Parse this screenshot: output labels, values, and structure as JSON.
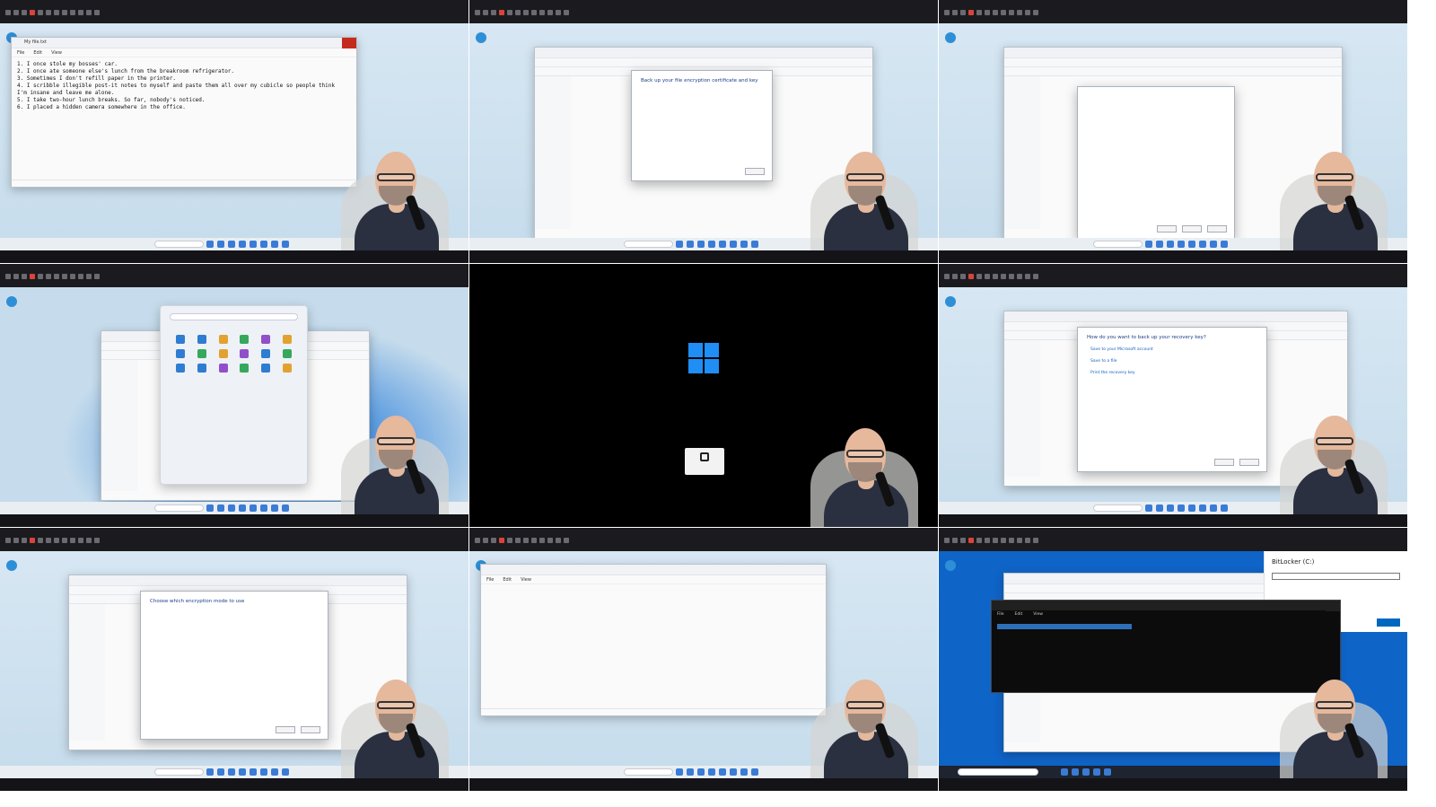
{
  "panel1": {
    "window_title": "My file.txt",
    "menu": [
      "File",
      "Edit",
      "View"
    ],
    "lines": [
      "1. I once stole my bosses' car.",
      "2. I once ate someone else's lunch from the breakroom refrigerator.",
      "3. Sometimes I don't refill paper in the printer.",
      "4. I scribble illegible post-it notes to myself and paste them all over my cubicle so people think",
      "I'm insane and leave me alone.",
      "5. I take two-hour lunch breaks. So far, nobody's noticed.",
      "6. I placed a hidden camera somewhere in the office."
    ]
  },
  "panel2": {
    "dialog_title": "Back up your file encryption certificate and key"
  },
  "panel6": {
    "dialog_title": "How do you want to back up your recovery key?",
    "options": [
      "Save to your Microsoft account",
      "Save to a file",
      "Print the recovery key"
    ]
  },
  "panel7": {
    "dialog_title": "Choose which encryption mode to use"
  },
  "panel8": {
    "menu": [
      "File",
      "Edit",
      "View"
    ]
  },
  "panel9": {
    "bitlocker_title": "BitLocker (C:)",
    "menu": [
      "File",
      "Edit",
      "View"
    ]
  },
  "colors": {
    "vm_bar": "#1b1b1f",
    "close_red": "#c42b1c",
    "windows_blue": "#1f8ef5",
    "selection_blue": "#2d6fb8"
  },
  "icons": [
    "windows-logo-icon",
    "lock-icon",
    "close-icon",
    "search-icon",
    "edge-icon",
    "start-icon"
  ]
}
